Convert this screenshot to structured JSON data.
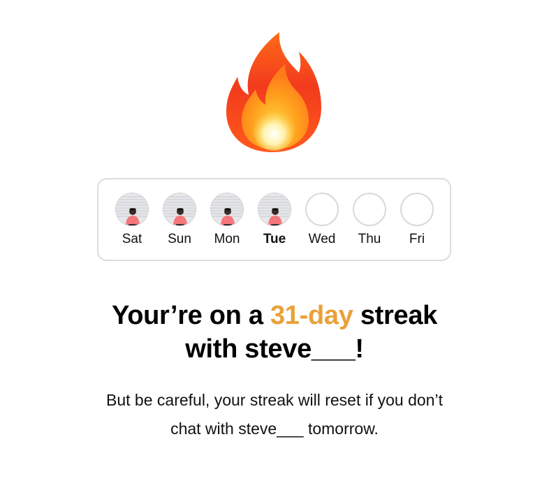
{
  "flame": {
    "icon": "fire-icon"
  },
  "week": {
    "days": [
      {
        "label": "Sat",
        "completed": true,
        "current": false
      },
      {
        "label": "Sun",
        "completed": true,
        "current": false
      },
      {
        "label": "Mon",
        "completed": true,
        "current": false
      },
      {
        "label": "Tue",
        "completed": true,
        "current": true
      },
      {
        "label": "Wed",
        "completed": false,
        "current": false
      },
      {
        "label": "Thu",
        "completed": false,
        "current": false
      },
      {
        "label": "Fri",
        "completed": false,
        "current": false
      }
    ]
  },
  "headline": {
    "prefix": "Your’re on a ",
    "highlight": "31-day",
    "suffix": " streak",
    "line2": "with steve___!",
    "accent_color": "#e9a13a"
  },
  "subtext": {
    "line1": "But be careful, your streak will reset if you don’t",
    "line2": "chat with steve___ tomorrow."
  }
}
